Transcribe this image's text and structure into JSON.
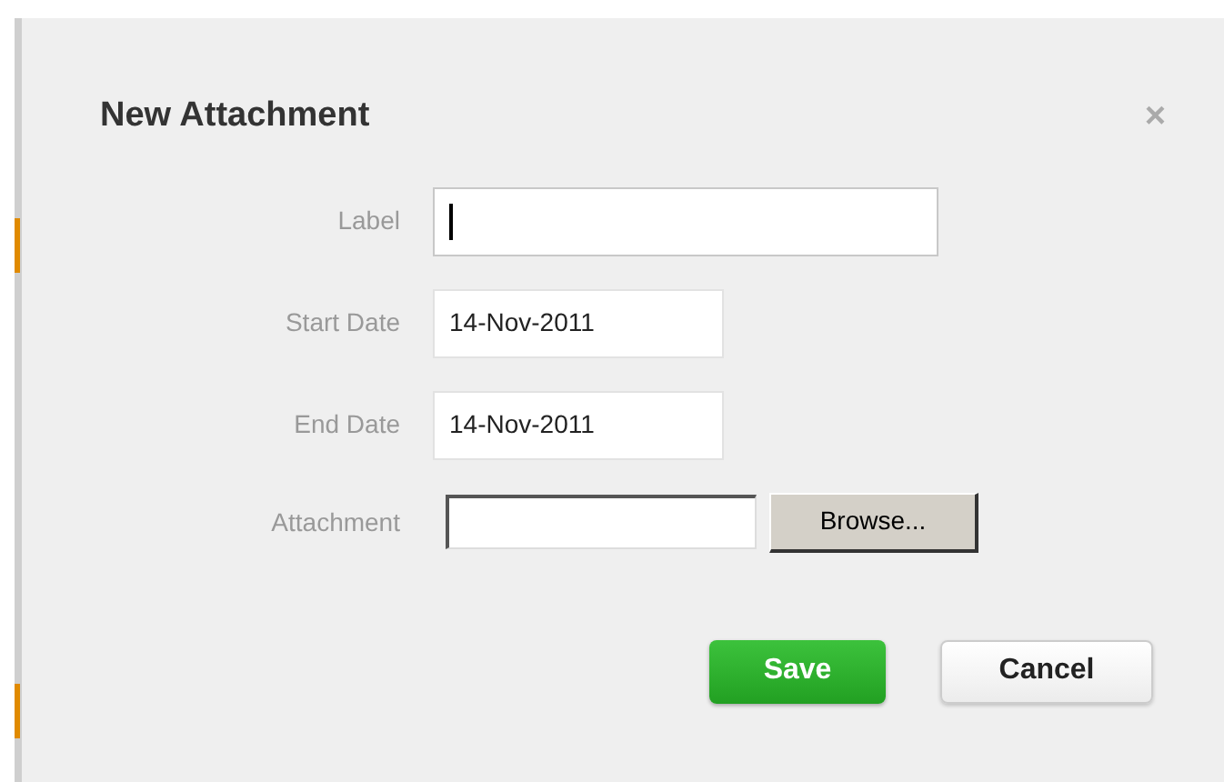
{
  "dialog": {
    "title": "New Attachment",
    "close": "×"
  },
  "fields": [
    {
      "kind": "text",
      "label": "Label",
      "focused": true
    },
    {
      "kind": "date",
      "label": "Start Date",
      "value": "14-Nov-2011",
      "focused": false
    },
    {
      "kind": "date",
      "label": "End Date",
      "value": "14-Nov-2011",
      "focused": false
    },
    {
      "kind": "file",
      "label": "Attachment",
      "button": "Browse...",
      "focused": false
    }
  ],
  "buttons": [
    {
      "kind": "primary",
      "label": "Save"
    },
    {
      "kind": "secondary",
      "label": "Cancel"
    }
  ]
}
